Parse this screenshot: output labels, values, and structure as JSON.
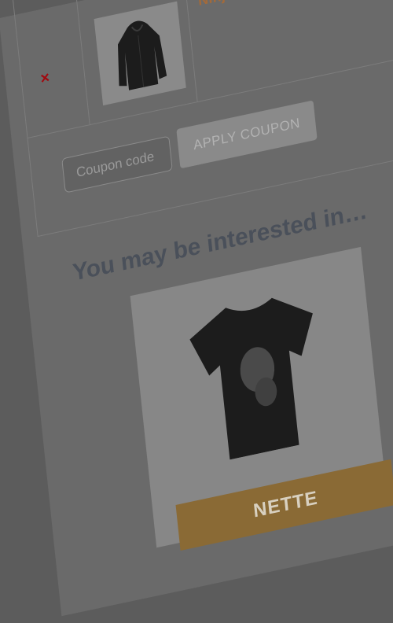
{
  "cart": {
    "product_name": "Ninja Si",
    "remove_symbol": "×"
  },
  "coupon": {
    "placeholder": "Coupon code",
    "apply_label": "APPLY COUPON"
  },
  "related": {
    "heading": "You may be interested in…",
    "product_label": "NETTE"
  },
  "icons": {
    "remove": "close-icon",
    "hoodie": "hoodie-product-image",
    "tshirt": "tshirt-product-image"
  },
  "colors": {
    "remove": "#a10a10",
    "product_link": "#a36a3a",
    "label_band": "#8a6a35"
  }
}
